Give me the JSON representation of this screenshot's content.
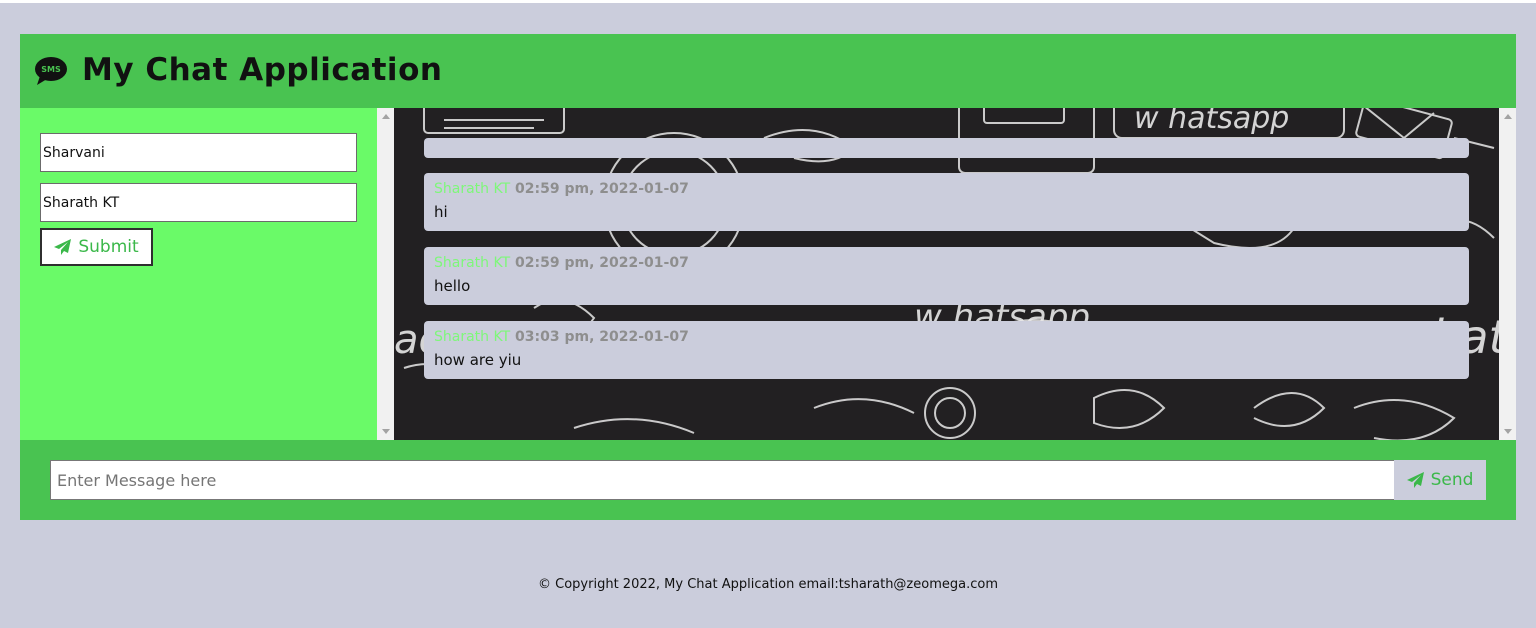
{
  "header": {
    "title": "My Chat Application",
    "icon": "sms-bubble-icon",
    "icon_text": "SMS"
  },
  "form": {
    "from_value": "Sharvani",
    "to_value": "Sharath KT",
    "submit_label": "Submit"
  },
  "chat": {
    "messages": [
      {
        "user": "Sharath KT",
        "timestamp": "02:59 pm, 2022-01-07",
        "text": "hi"
      },
      {
        "user": "Sharath KT",
        "timestamp": "02:59 pm, 2022-01-07",
        "text": "hello"
      },
      {
        "user": "Sharath KT",
        "timestamp": "03:03 pm, 2022-01-07",
        "text": "how are yiu"
      }
    ]
  },
  "composer": {
    "placeholder": "Enter Message here",
    "send_label": "Send"
  },
  "footer": {
    "text": "© Copyright 2022, My Chat Application email:tsharath@zeomega.com"
  },
  "colors": {
    "header_green": "#49c351",
    "sidebar_green": "#6afa68",
    "page_bg": "#cbcddc",
    "chat_bg": "#222022",
    "accent_text_green": "#3bb84a"
  }
}
